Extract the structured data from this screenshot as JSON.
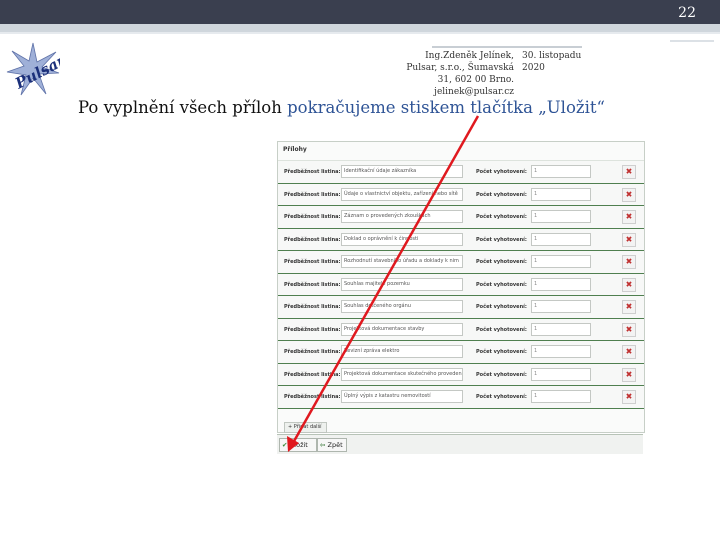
{
  "slide": {
    "number": "22"
  },
  "logo": {
    "text": "Pulsar"
  },
  "author": {
    "line1": "Ing.Zdeněk Jelínek,",
    "line2": "Pulsar, s.r.o., Šumavská",
    "line3": "31, 602 00 Brno.",
    "line4": "jelinek@pulsar.cz"
  },
  "date": {
    "line1": "30. listopadu",
    "line2": "2020"
  },
  "heading": {
    "part1": "Po vyplnění všech příloh ",
    "part2": "pokračujeme stiskem tlačítka „Uložit“"
  },
  "form": {
    "title": "Přílohy",
    "label_attachment": "Předběžnost listina:",
    "label_count": "Počet vyhotovení:",
    "rows": [
      {
        "name": "Identifikační údaje zákazníka",
        "count": "1"
      },
      {
        "name": "Údaje o vlastnictví objektu, zařízení nebo sítě",
        "count": "1"
      },
      {
        "name": "Záznam o provedených zkouškách",
        "count": "1"
      },
      {
        "name": "Doklad o oprávnění k činnosti",
        "count": "1"
      },
      {
        "name": "Rozhodnutí stavebního úřadu a doklady k nim",
        "count": "1"
      },
      {
        "name": "Souhlas majitele pozemku",
        "count": "1"
      },
      {
        "name": "Souhlas dotčeného orgánu",
        "count": "1"
      },
      {
        "name": "Projektová dokumentace stavby",
        "count": "1"
      },
      {
        "name": "Revizní zpráva elektro",
        "count": "1"
      },
      {
        "name": "Projektová dokumentace skutečného provedení",
        "count": "1"
      },
      {
        "name": "Úplný výpis z katastru nemovitostí",
        "count": "1"
      }
    ],
    "add_label": "Přidat další",
    "save_label": "Uložit",
    "back_label": "Zpět"
  }
}
